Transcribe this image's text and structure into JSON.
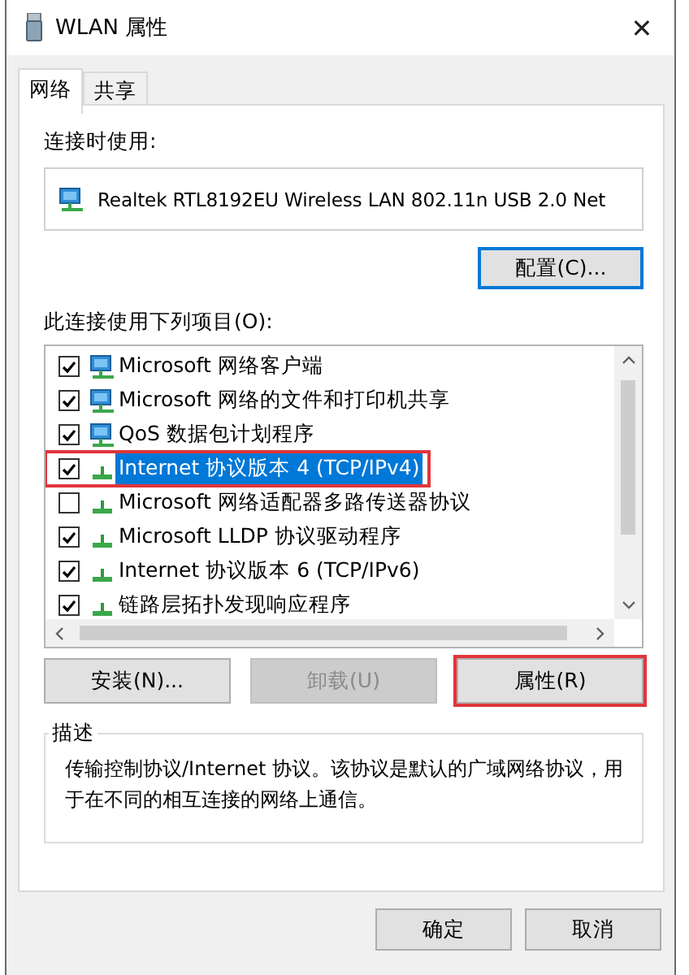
{
  "window": {
    "title": "WLAN 属性",
    "close": "✕"
  },
  "tabs": [
    {
      "label": "网络",
      "selected": true
    },
    {
      "label": "共享",
      "selected": false
    }
  ],
  "connect_label": "连接时使用:",
  "adapter": "Realtek RTL8192EU Wireless LAN 802.11n USB 2.0 Net",
  "configure_button": "配置(C)...",
  "items_label": "此连接使用下列项目(O):",
  "items": [
    {
      "label": "Microsoft 网络客户端",
      "kind": "client",
      "checked": true,
      "selected": false,
      "highlighted": false
    },
    {
      "label": "Microsoft 网络的文件和打印机共享",
      "kind": "client",
      "checked": true,
      "selected": false,
      "highlighted": false
    },
    {
      "label": "QoS 数据包计划程序",
      "kind": "client",
      "checked": true,
      "selected": false,
      "highlighted": false
    },
    {
      "label": "Internet 协议版本 4 (TCP/IPv4)",
      "kind": "protocol",
      "checked": true,
      "selected": true,
      "highlighted": true
    },
    {
      "label": "Microsoft 网络适配器多路传送器协议",
      "kind": "protocol",
      "checked": false,
      "selected": false,
      "highlighted": false
    },
    {
      "label": "Microsoft LLDP 协议驱动程序",
      "kind": "protocol",
      "checked": true,
      "selected": false,
      "highlighted": false
    },
    {
      "label": "Internet 协议版本 6 (TCP/IPv6)",
      "kind": "protocol",
      "checked": true,
      "selected": false,
      "highlighted": false
    },
    {
      "label": "链路层拓扑发现响应程序",
      "kind": "protocol",
      "checked": true,
      "selected": false,
      "highlighted": false
    }
  ],
  "buttons": [
    {
      "label": "安装(N)...",
      "disabled": false,
      "highlighted": false
    },
    {
      "label": "卸载(U)",
      "disabled": true,
      "highlighted": false
    },
    {
      "label": "属性(R)",
      "disabled": false,
      "highlighted": true
    }
  ],
  "description": {
    "title": "描述",
    "text": "传输控制协议/Internet 协议。该协议是默认的广域网络协议，用于在不同的相互连接的网络上通信。"
  },
  "dialog_buttons": [
    "确定",
    "取消"
  ]
}
